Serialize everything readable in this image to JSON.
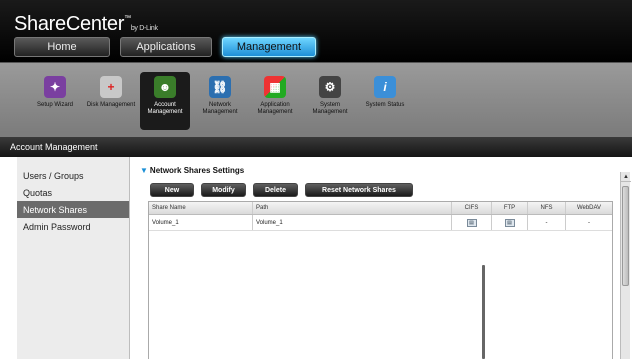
{
  "header": {
    "brand": "ShareCenter",
    "brand_tm": "™",
    "brand_by": "by D-Link",
    "nav": [
      {
        "label": "Home"
      },
      {
        "label": "Applications"
      },
      {
        "label": "Management"
      }
    ]
  },
  "toolbar": {
    "items": [
      {
        "label": "Setup Wizard",
        "icon": "wizard-icon"
      },
      {
        "label": "Disk Management",
        "icon": "disk-icon"
      },
      {
        "label": "Account Management",
        "icon": "account-icon"
      },
      {
        "label": "Network Management",
        "icon": "network-icon"
      },
      {
        "label": "Application Management",
        "icon": "application-icon"
      },
      {
        "label": "System Management",
        "icon": "system-icon"
      },
      {
        "label": "System Status",
        "icon": "info-icon"
      }
    ]
  },
  "section_title": "Account Management",
  "sidebar": {
    "items": [
      {
        "label": "Users / Groups"
      },
      {
        "label": "Quotas"
      },
      {
        "label": "Network Shares"
      },
      {
        "label": "Admin Password"
      }
    ]
  },
  "main": {
    "title": "Network Shares Settings",
    "buttons": {
      "new": "New",
      "modify": "Modify",
      "delete": "Delete",
      "reset": "Reset Network Shares"
    },
    "table": {
      "columns": [
        "Share Name",
        "Path",
        "CIFS",
        "FTP",
        "NFS",
        "WebDAV"
      ],
      "rows": [
        {
          "share_name": "Volume_1",
          "path": "Volume_1",
          "nfs": "-",
          "webdav": "-"
        }
      ]
    }
  },
  "colors": {
    "accent": "#1e8fd6",
    "selected_sidebar": "#6b6b6b"
  }
}
